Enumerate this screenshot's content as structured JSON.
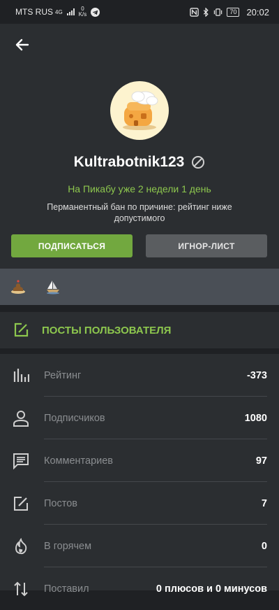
{
  "status_bar": {
    "carrier": "MTS RUS",
    "network": "4G",
    "speed_value": "0",
    "speed_unit": "K/s",
    "battery": "70",
    "time": "20:02"
  },
  "profile": {
    "username": "Kultrabotnik123",
    "on_site": "На Пикабу уже 2 недели 1 день",
    "ban_reason": "Перманентный бан по причине: рейтинг ниже допустимого",
    "subscribe_label": "ПОДПИСАТЬСЯ",
    "ignore_label": "ИГНОР-ЛИСТ"
  },
  "posts_section": {
    "label": "ПОСТЫ ПОЛЬЗОВАТЕЛЯ"
  },
  "stats": [
    {
      "label": "Рейтинг",
      "value": "-373",
      "icon": "rating-bars-icon"
    },
    {
      "label": "Подписчиков",
      "value": "1080",
      "icon": "person-icon"
    },
    {
      "label": "Комментариев",
      "value": "97",
      "icon": "comment-icon"
    },
    {
      "label": "Постов",
      "value": "7",
      "icon": "edit-icon"
    },
    {
      "label": "В горячем",
      "value": "0",
      "icon": "flame-icon"
    },
    {
      "label": "Поставил",
      "value": "0 плюсов и 0 минусов",
      "icon": "sort-arrows-icon"
    }
  ],
  "colors": {
    "accent_green": "#8dc74e",
    "button_green": "#72a83f",
    "button_gray": "#5a5d60",
    "background": "#1f2124",
    "panel": "#2b2e31"
  }
}
